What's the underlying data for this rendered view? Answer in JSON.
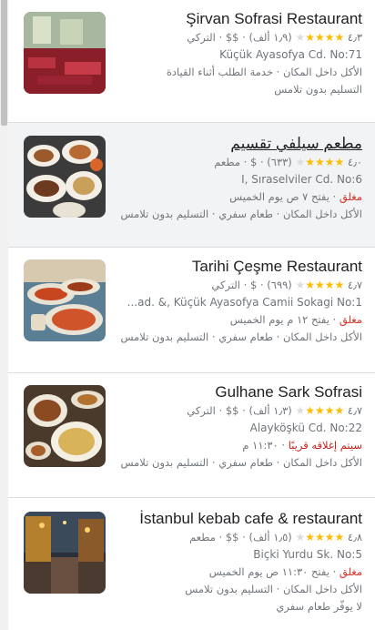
{
  "results": [
    {
      "name": "Şirvan Sofrasi Restaurant",
      "rating": "٤٫٣",
      "stars": "★★★★",
      "stars_off": "★",
      "reviews": "(١٫٩ ألف)",
      "price": "$$",
      "category": "التركي",
      "address": "Küçük Ayasofya Cd. No:71",
      "status_label": "",
      "status_detail": "",
      "services_line1": "الأكل داخل المكان · خدمة الطلب أثناء القيادة",
      "services_line2": "التسليم بدون تلامس"
    },
    {
      "name": "مطعم سيلفي تقسيم",
      "rating": "٤٫٠",
      "stars": "★★★★",
      "stars_off": "★",
      "reviews": "(٦٣٣)",
      "price": "$",
      "category": "مطعم",
      "address": "I, Sıraselviler Cd. No:6",
      "status_label": "مغلق",
      "status_detail": " · يفتح ٧ ص يوم الخميس",
      "services_line1": "الأكل داخل المكان · طعام سفري · التسليم بدون تلامس",
      "services_line2": ""
    },
    {
      "name": "Tarihi Çeşme Restaurant",
      "rating": "٤٫٧",
      "stars": "★★★★",
      "stars_off": "★",
      "reviews": "(٦٩٩)",
      "price": "$",
      "category": "التركي",
      "address": "...ad. &, Küçük Ayasofya Camii Sokagi No:1",
      "status_label": "مغلق",
      "status_detail": " · يفتح ١٢ م يوم الخميس",
      "services_line1": "الأكل داخل المكان · طعام سفري · التسليم بدون تلامس",
      "services_line2": ""
    },
    {
      "name": "Gulhane Sark Sofrasi",
      "rating": "٤٫٧",
      "stars": "★★★★",
      "stars_off": "★",
      "reviews": "(١٫٣ ألف)",
      "price": "$$",
      "category": "التركي",
      "address": "Alayköşkü Cd. No:22",
      "status_label": "سيتم إغلاقه قريبًا",
      "status_detail": " · ١١:٣٠ م",
      "services_line1": "الأكل داخل المكان · طعام سفري · التسليم بدون تلامس",
      "services_line2": ""
    },
    {
      "name": "İstanbul kebab cafe & restaurant",
      "rating": "٤٫٨",
      "stars": "★★★★",
      "stars_off": "★",
      "reviews": "(١٫٥ ألف)",
      "price": "$$",
      "category": "مطعم",
      "address": "Biçki Yurdu Sk. No:5",
      "status_label": "مغلق",
      "status_detail": " · يفتح ١١:٣٠ ص يوم الخميس",
      "services_line1": "الأكل داخل المكان · التسليم بدون تلامس",
      "services_line2": "لا يوفّر طعام سفري"
    }
  ]
}
